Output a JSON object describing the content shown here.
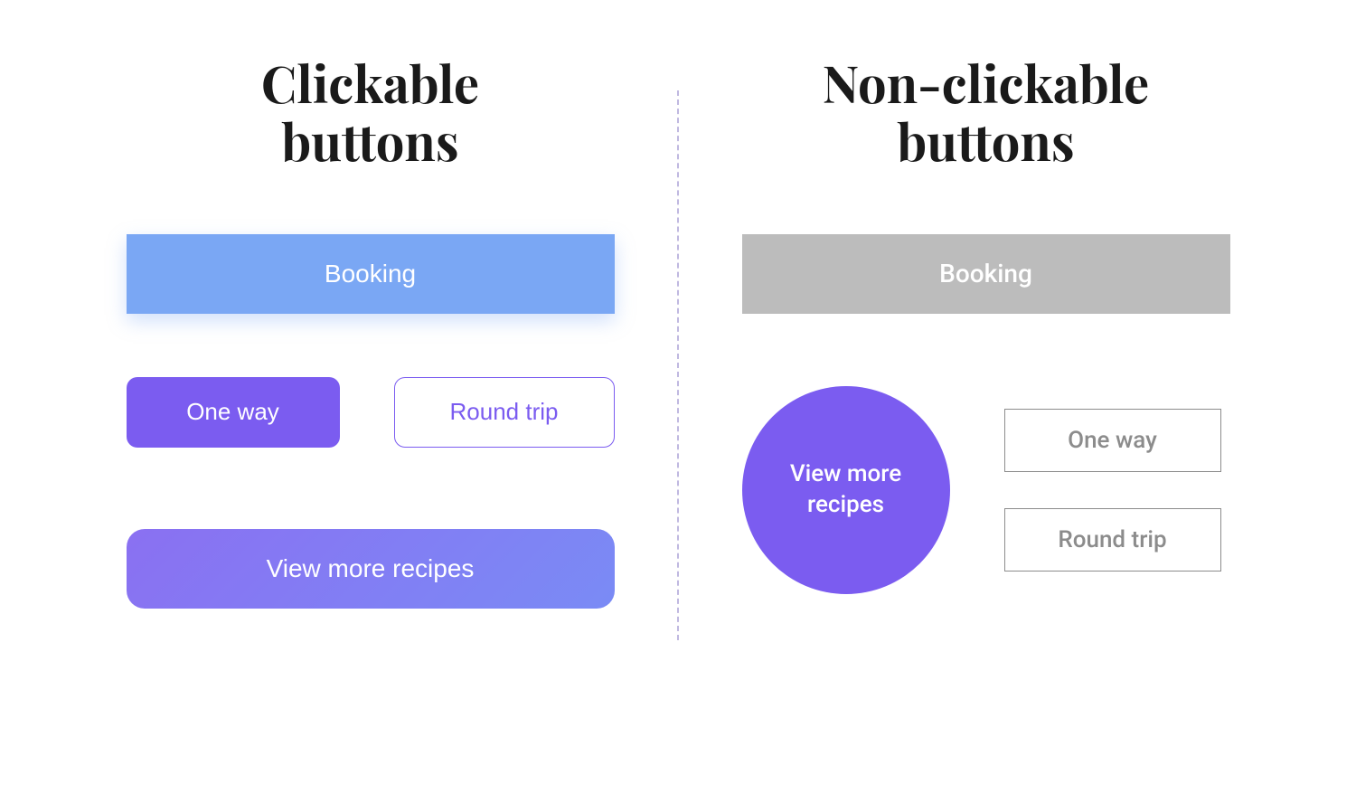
{
  "left": {
    "heading_line1": "Clickable",
    "heading_line2": "buttons",
    "booking_label": "Booking",
    "oneway_label": "One way",
    "roundtrip_label": "Round trip",
    "viewmore_label": "View more recipes"
  },
  "right": {
    "heading_line1": "Non-clickable",
    "heading_line2": "buttons",
    "booking_label": "Booking",
    "viewmore_line1": "View more",
    "viewmore_line2": "recipes",
    "oneway_label": "One way",
    "roundtrip_label": "Round trip"
  },
  "colors": {
    "blue": "#7aa7f4",
    "purple": "#7b5cf0",
    "gradient_start": "#8a70f2",
    "gradient_end": "#7a8bf5",
    "gray": "#bcbcbc",
    "gray_text": "#8c8c8c",
    "divider": "#c0b8e0"
  }
}
